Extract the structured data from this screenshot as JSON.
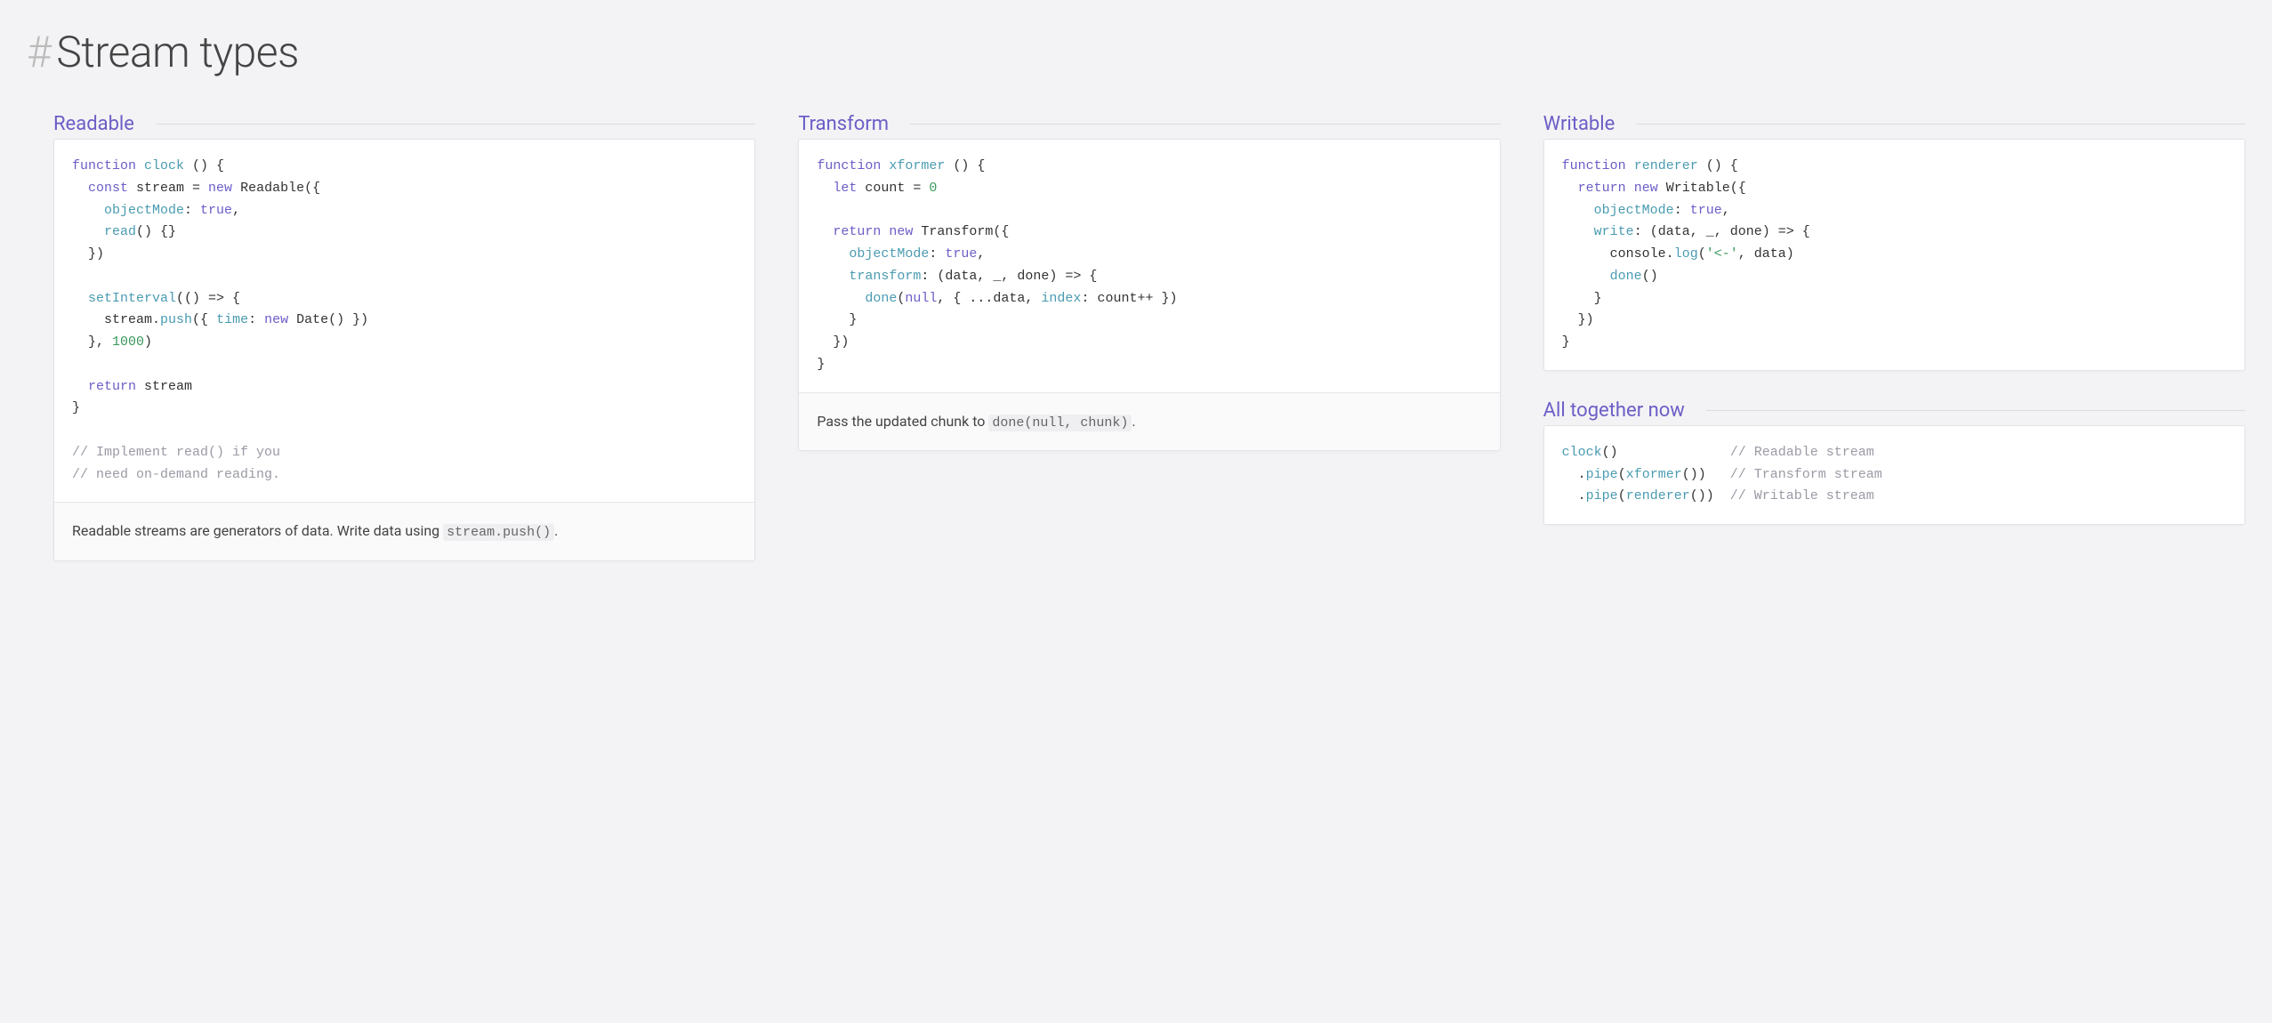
{
  "title": "Stream types",
  "columns": [
    {
      "sections": [
        {
          "heading": "Readable",
          "code": [
            {
              "t": "kw",
              "v": "function"
            },
            {
              "t": "",
              "v": " "
            },
            {
              "t": "fn",
              "v": "clock"
            },
            {
              "t": "",
              "v": " () {\n"
            },
            {
              "t": "",
              "v": "  "
            },
            {
              "t": "kw",
              "v": "const"
            },
            {
              "t": "",
              "v": " stream = "
            },
            {
              "t": "kw",
              "v": "new"
            },
            {
              "t": "",
              "v": " Readable({\n"
            },
            {
              "t": "",
              "v": "    "
            },
            {
              "t": "prop",
              "v": "objectMode"
            },
            {
              "t": "",
              "v": ": "
            },
            {
              "t": "bool",
              "v": "true"
            },
            {
              "t": "",
              "v": ",\n"
            },
            {
              "t": "",
              "v": "    "
            },
            {
              "t": "fn",
              "v": "read"
            },
            {
              "t": "",
              "v": "() {}\n"
            },
            {
              "t": "",
              "v": "  })\n"
            },
            {
              "t": "",
              "v": "\n"
            },
            {
              "t": "",
              "v": "  "
            },
            {
              "t": "fn",
              "v": "setInterval"
            },
            {
              "t": "",
              "v": "(() => {\n"
            },
            {
              "t": "",
              "v": "    stream."
            },
            {
              "t": "fn",
              "v": "push"
            },
            {
              "t": "",
              "v": "({ "
            },
            {
              "t": "prop",
              "v": "time"
            },
            {
              "t": "",
              "v": ": "
            },
            {
              "t": "kw",
              "v": "new"
            },
            {
              "t": "",
              "v": " Date() })\n"
            },
            {
              "t": "",
              "v": "  }, "
            },
            {
              "t": "num",
              "v": "1000"
            },
            {
              "t": "",
              "v": ")\n"
            },
            {
              "t": "",
              "v": "\n"
            },
            {
              "t": "",
              "v": "  "
            },
            {
              "t": "kw",
              "v": "return"
            },
            {
              "t": "",
              "v": " stream\n"
            },
            {
              "t": "",
              "v": "}\n"
            },
            {
              "t": "",
              "v": "\n"
            },
            {
              "t": "cmt",
              "v": "// Implement read() if you\n"
            },
            {
              "t": "cmt",
              "v": "// need on-demand reading."
            }
          ],
          "caption_parts": [
            {
              "t": "text",
              "v": "Readable streams are generators of data. Write data using "
            },
            {
              "t": "code",
              "v": "stream.push()"
            },
            {
              "t": "text",
              "v": "."
            }
          ]
        }
      ]
    },
    {
      "sections": [
        {
          "heading": "Transform",
          "code": [
            {
              "t": "kw",
              "v": "function"
            },
            {
              "t": "",
              "v": " "
            },
            {
              "t": "fn",
              "v": "xformer"
            },
            {
              "t": "",
              "v": " () {\n"
            },
            {
              "t": "",
              "v": "  "
            },
            {
              "t": "kw",
              "v": "let"
            },
            {
              "t": "",
              "v": " count = "
            },
            {
              "t": "num",
              "v": "0"
            },
            {
              "t": "",
              "v": "\n"
            },
            {
              "t": "",
              "v": "\n"
            },
            {
              "t": "",
              "v": "  "
            },
            {
              "t": "kw",
              "v": "return"
            },
            {
              "t": "",
              "v": " "
            },
            {
              "t": "kw",
              "v": "new"
            },
            {
              "t": "",
              "v": " Transform({\n"
            },
            {
              "t": "",
              "v": "    "
            },
            {
              "t": "prop",
              "v": "objectMode"
            },
            {
              "t": "",
              "v": ": "
            },
            {
              "t": "bool",
              "v": "true"
            },
            {
              "t": "",
              "v": ",\n"
            },
            {
              "t": "",
              "v": "    "
            },
            {
              "t": "prop",
              "v": "transform"
            },
            {
              "t": "",
              "v": ": (data, _, done) => {\n"
            },
            {
              "t": "",
              "v": "      "
            },
            {
              "t": "fn",
              "v": "done"
            },
            {
              "t": "",
              "v": "("
            },
            {
              "t": "bool",
              "v": "null"
            },
            {
              "t": "",
              "v": ", { ...data, "
            },
            {
              "t": "prop",
              "v": "index"
            },
            {
              "t": "",
              "v": ": count++ })\n"
            },
            {
              "t": "",
              "v": "    }\n"
            },
            {
              "t": "",
              "v": "  })\n"
            },
            {
              "t": "",
              "v": "}"
            }
          ],
          "caption_parts": [
            {
              "t": "text",
              "v": "Pass the updated chunk to "
            },
            {
              "t": "code",
              "v": "done(null, chunk)"
            },
            {
              "t": "text",
              "v": "."
            }
          ]
        }
      ]
    },
    {
      "sections": [
        {
          "heading": "Writable",
          "code": [
            {
              "t": "kw",
              "v": "function"
            },
            {
              "t": "",
              "v": " "
            },
            {
              "t": "fn",
              "v": "renderer"
            },
            {
              "t": "",
              "v": " () {\n"
            },
            {
              "t": "",
              "v": "  "
            },
            {
              "t": "kw",
              "v": "return"
            },
            {
              "t": "",
              "v": " "
            },
            {
              "t": "kw",
              "v": "new"
            },
            {
              "t": "",
              "v": " Writable({\n"
            },
            {
              "t": "",
              "v": "    "
            },
            {
              "t": "prop",
              "v": "objectMode"
            },
            {
              "t": "",
              "v": ": "
            },
            {
              "t": "bool",
              "v": "true"
            },
            {
              "t": "",
              "v": ",\n"
            },
            {
              "t": "",
              "v": "    "
            },
            {
              "t": "prop",
              "v": "write"
            },
            {
              "t": "",
              "v": ": (data, _, done) => {\n"
            },
            {
              "t": "",
              "v": "      console."
            },
            {
              "t": "fn",
              "v": "log"
            },
            {
              "t": "",
              "v": "("
            },
            {
              "t": "str",
              "v": "'<-'"
            },
            {
              "t": "",
              "v": ", data)\n"
            },
            {
              "t": "",
              "v": "      "
            },
            {
              "t": "fn",
              "v": "done"
            },
            {
              "t": "",
              "v": "()\n"
            },
            {
              "t": "",
              "v": "    }\n"
            },
            {
              "t": "",
              "v": "  })\n"
            },
            {
              "t": "",
              "v": "}"
            }
          ]
        },
        {
          "heading": "All together now",
          "code": [
            {
              "t": "fn",
              "v": "clock"
            },
            {
              "t": "",
              "v": "()              "
            },
            {
              "t": "cmt",
              "v": "// Readable stream"
            },
            {
              "t": "",
              "v": "\n"
            },
            {
              "t": "",
              "v": "  ."
            },
            {
              "t": "fn",
              "v": "pipe"
            },
            {
              "t": "",
              "v": "("
            },
            {
              "t": "fn",
              "v": "xformer"
            },
            {
              "t": "",
              "v": "())   "
            },
            {
              "t": "cmt",
              "v": "// Transform stream"
            },
            {
              "t": "",
              "v": "\n"
            },
            {
              "t": "",
              "v": "  ."
            },
            {
              "t": "fn",
              "v": "pipe"
            },
            {
              "t": "",
              "v": "("
            },
            {
              "t": "fn",
              "v": "renderer"
            },
            {
              "t": "",
              "v": "())  "
            },
            {
              "t": "cmt",
              "v": "// Writable stream"
            }
          ]
        }
      ]
    }
  ]
}
